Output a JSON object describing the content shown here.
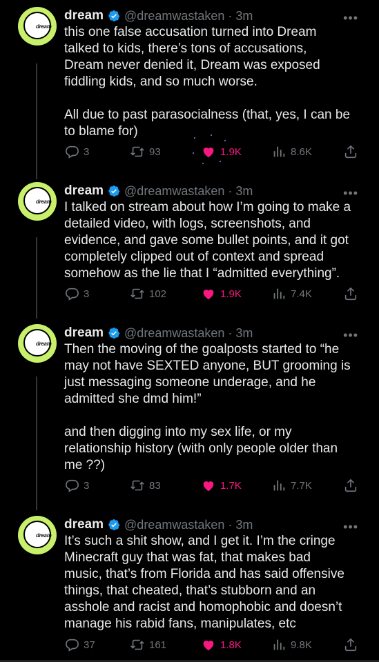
{
  "tweets": [
    {
      "name": "dream",
      "handle": "@dreamwastaken",
      "time": "3m",
      "avatar_text": "dream",
      "text": "this one false accusation turned into Dream\ntalked to kids, there’s tons of accusations,\nDream never denied it, Dream was exposed\nfiddling kids, and so much worse.\n\nAll due to past parasocialness (that, yes, I can be\nto blame for)",
      "replies": "3",
      "retweets": "93",
      "likes": "1.9K",
      "views": "8.6K"
    },
    {
      "name": "dream",
      "handle": "@dreamwastaken",
      "time": "3m",
      "avatar_text": "dream",
      "text": "I talked on stream about how I’m going to make a\ndetailed video, with logs, screenshots, and\nevidence, and gave some bullet points, and it got\ncompletely clipped out of context and spread\nsomehow as the lie that I “admitted everything”.",
      "replies": "3",
      "retweets": "102",
      "likes": "1.9K",
      "views": "7.4K"
    },
    {
      "name": "dream",
      "handle": "@dreamwastaken",
      "time": "3m",
      "avatar_text": "dream",
      "text": "Then the moving of the goalposts started to “he\nmay not have SEXTED anyone, BUT grooming is\njust messaging someone underage, and he\nadmitted she dmd him!”\n\nand then digging into my sex life, or my\nrelationship history (with only people older than\nme ??)",
      "replies": "3",
      "retweets": "83",
      "likes": "1.7K",
      "views": "7.7K"
    },
    {
      "name": "dream",
      "handle": "@dreamwastaken",
      "time": "3m",
      "avatar_text": "dream",
      "text": "It’s such a shit show, and I get it. I’m the cringe\nMinecraft guy that was fat, that makes bad\nmusic, that’s from Florida and has said offensive\nthings, that cheated, that’s stubborn and an\nasshole and racist and homophobic and doesn’t\nmanage his rabid fans, manipulates, etc",
      "replies": "37",
      "retweets": "161",
      "likes": "1.8K",
      "views": "9.8K"
    }
  ],
  "colors": {
    "background": "#000000",
    "text": "#e7e9ea",
    "muted": "#71767b",
    "like": "#f91880",
    "verified": "#1d9bf0",
    "avatar_bg": "#c9f06a"
  },
  "icons": [
    "reply-icon",
    "retweet-icon",
    "like-icon",
    "views-icon",
    "share-icon",
    "verified-badge-icon",
    "more-icon"
  ]
}
